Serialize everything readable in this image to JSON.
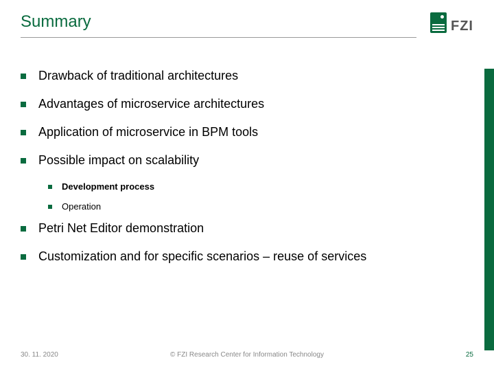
{
  "header": {
    "title": "Summary",
    "logo_text": "FZI"
  },
  "bullets": {
    "b1": "Drawback of traditional architectures",
    "b2": "Advantages of microservice architectures",
    "b3": "Application of microservice in BPM tools",
    "b4": "Possible impact on scalability",
    "b4_sub1": "Development process",
    "b4_sub2": "Operation",
    "b5": "Petri Net Editor demonstration",
    "b6": "Customization and for specific scenarios – reuse of services"
  },
  "footer": {
    "date": "30. 11. 2020",
    "copyright": "© FZI Research Center for Information Technology",
    "page": "25"
  }
}
